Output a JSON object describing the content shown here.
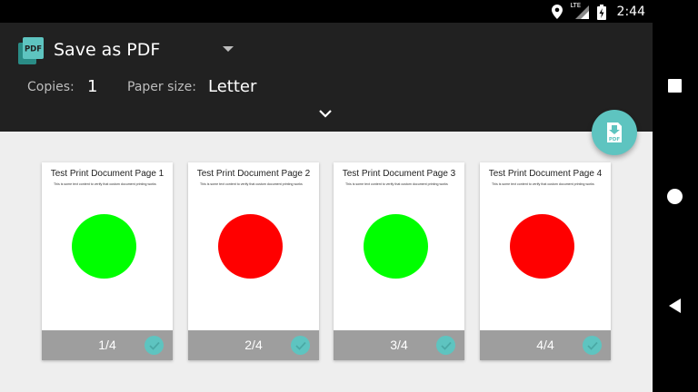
{
  "status_bar": {
    "time": "2:44",
    "network_label": "LTE"
  },
  "header": {
    "destination": "Save as PDF",
    "copies_label": "Copies:",
    "copies_value": "1",
    "paper_size_label": "Paper size:",
    "paper_size_value": "Letter"
  },
  "colors": {
    "accent": "#5ec4c0",
    "header_bg": "#212121",
    "green": "#00ff00",
    "red": "#ff0000",
    "footer_gray": "#9e9e9e"
  },
  "pages": [
    {
      "title": "Test Print Document Page 1",
      "subtext": "This is some text content to verify that custom document printing works",
      "page_number": "1/4",
      "circle_color": "#00ff00"
    },
    {
      "title": "Test Print Document Page 2",
      "subtext": "This is some text content to verify that custom document printing works",
      "page_number": "2/4",
      "circle_color": "#ff0000"
    },
    {
      "title": "Test Print Document Page 3",
      "subtext": "This is some text content to verify that custom document printing works",
      "page_number": "3/4",
      "circle_color": "#00ff00"
    },
    {
      "title": "Test Print Document Page 4",
      "subtext": "This is some text content to verify that custom document printing works",
      "page_number": "4/4",
      "circle_color": "#ff0000"
    }
  ],
  "icons": {
    "pdf_logo": "pdf-icon",
    "dropdown": "arrow-drop-down-icon",
    "expand": "chevron-down-icon",
    "fab": "pdf-download-icon",
    "page_selected": "check-circle-icon",
    "nav_recents": "square-icon",
    "nav_home": "circle-icon",
    "nav_back": "triangle-back-icon"
  }
}
